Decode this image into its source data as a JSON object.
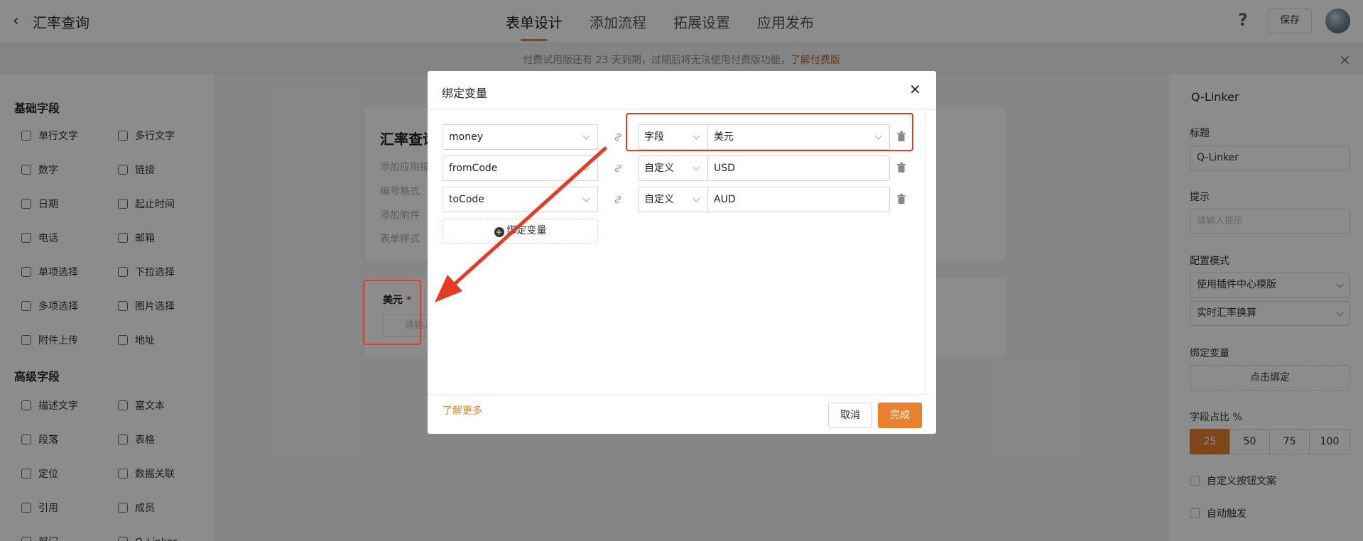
{
  "header": {
    "title": "汇率查询",
    "tabs": [
      {
        "label": "表单设计",
        "active": true
      },
      {
        "label": "添加流程"
      },
      {
        "label": "拓展设置"
      },
      {
        "label": "应用发布"
      }
    ],
    "help_icon": "?",
    "save_label": "保存",
    "accent_color": "#e8802f"
  },
  "banner": {
    "text": "付费试用版还有 23 天到期，过期后将无法使用付费版功能，",
    "link": "了解付费版",
    "close": "×"
  },
  "sidebar": {
    "basic_title": "基础字段",
    "basic_items": [
      {
        "label": "单行文字",
        "icon": "text-line-icon"
      },
      {
        "label": "多行文字",
        "icon": "text-multi-icon"
      },
      {
        "label": "数字",
        "icon": "number-icon"
      },
      {
        "label": "链接",
        "icon": "link-icon"
      },
      {
        "label": "日期",
        "icon": "calendar-icon"
      },
      {
        "label": "起止时间",
        "icon": "clock-icon"
      },
      {
        "label": "电话",
        "icon": "phone-icon"
      },
      {
        "label": "邮箱",
        "icon": "mail-icon"
      },
      {
        "label": "单项选择",
        "icon": "radio-icon"
      },
      {
        "label": "下拉选择",
        "icon": "dropdown-icon"
      },
      {
        "label": "多项选择",
        "icon": "checkbox-icon"
      },
      {
        "label": "图片选择",
        "icon": "image-icon"
      },
      {
        "label": "附件上传",
        "icon": "upload-icon"
      },
      {
        "label": "地址",
        "icon": "location-icon"
      }
    ],
    "advanced_title": "高级字段",
    "advanced_items": [
      {
        "label": "描述文字",
        "icon": "description-icon"
      },
      {
        "label": "富文本",
        "icon": "richtext-icon"
      },
      {
        "label": "段落",
        "icon": "paragraph-icon"
      },
      {
        "label": "表格",
        "icon": "table-icon"
      },
      {
        "label": "定位",
        "icon": "pin-icon"
      },
      {
        "label": "数据关联",
        "icon": "data-link-icon"
      },
      {
        "label": "引用",
        "icon": "quote-icon"
      },
      {
        "label": "成员",
        "icon": "member-icon"
      },
      {
        "label": "部门",
        "icon": "department-icon"
      },
      {
        "label": "Q-Linker",
        "icon": "qlinker-icon"
      }
    ]
  },
  "canvas": {
    "form_title": "汇率查询",
    "hint_lines": [
      "添加应用描述",
      "编号格式",
      "添加附件",
      "表单样式"
    ],
    "field_label": "美元",
    "required_mark": "*",
    "field_placeholder": "请输入"
  },
  "right_panel": {
    "title": "Q-Linker",
    "label_title": "标题",
    "title_value": "Q-Linker",
    "label_hint": "提示",
    "hint_placeholder": "请输入提示",
    "label_mode": "配置模式",
    "mode_value": "使用插件中心模版",
    "template_value": "实时汇率换算",
    "label_bind": "绑定变量",
    "bind_button": "点击绑定",
    "label_width": "字段占比 %",
    "width_options": [
      "25",
      "50",
      "75",
      "100"
    ],
    "width_selected": "25",
    "check_custom_button": "自定义按钮文案",
    "check_auto_trigger": "自动触发"
  },
  "modal": {
    "title": "绑定变量",
    "rows": [
      {
        "variable": "money",
        "source_type": "字段",
        "value": "美元",
        "value_is_select": true
      },
      {
        "variable": "fromCode",
        "source_type": "自定义",
        "value": "USD",
        "value_is_select": false
      },
      {
        "variable": "toCode",
        "source_type": "自定义",
        "value": "AUD",
        "value_is_select": false
      }
    ],
    "add_button": "绑定变量",
    "learn_more": "了解更多",
    "cancel": "取消",
    "confirm": "完成",
    "annotation_color": "#e63a22"
  }
}
